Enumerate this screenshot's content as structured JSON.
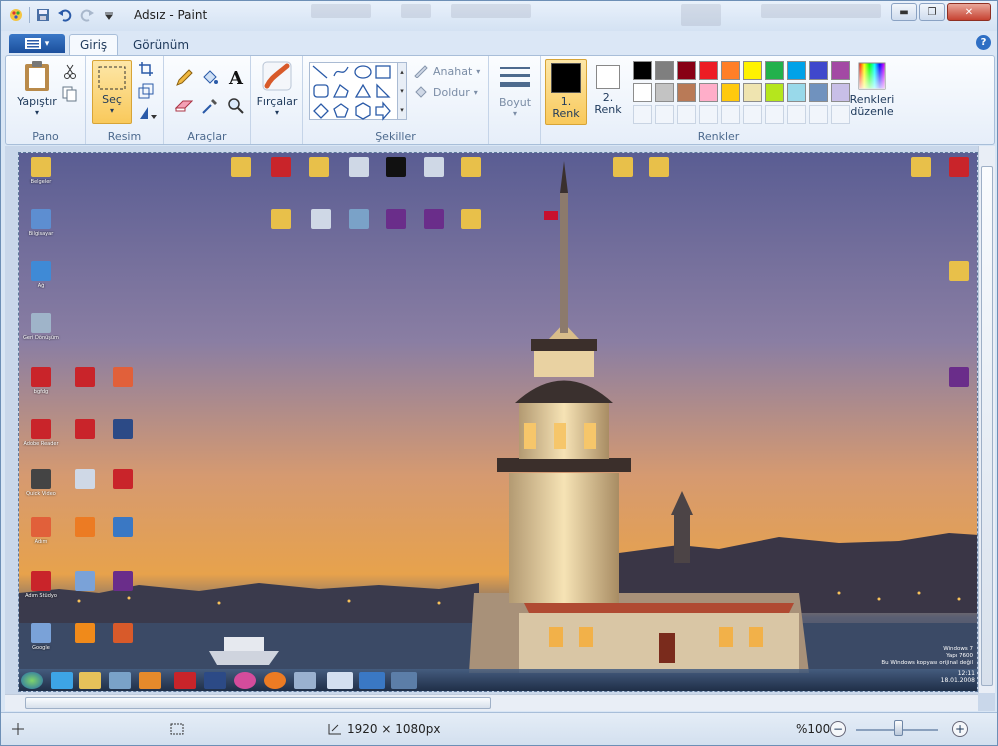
{
  "window": {
    "title": "Adsız - Paint",
    "min_glyph": "▬",
    "max_glyph": "❐",
    "close_glyph": "✕"
  },
  "tabs": {
    "app_menu_glyph": "▾",
    "items": [
      "Giriş",
      "Görünüm"
    ],
    "help_glyph": "?"
  },
  "ribbon": {
    "pano": {
      "label": "Pano",
      "paste": "Yapıştır"
    },
    "resim": {
      "label": "Resim",
      "select": "Seç"
    },
    "araclar": {
      "label": "Araçlar"
    },
    "fircalar": {
      "label": "Fırçalar"
    },
    "sekiller": {
      "label": "Şekiller",
      "outline": "Anahat",
      "fill": "Doldur"
    },
    "boyut": {
      "label": "Boyut"
    },
    "renkler": {
      "label": "Renkler",
      "color1": "1.\nRenk",
      "color1_a": "1.",
      "color1_b": "Renk",
      "color2_a": "2.",
      "color2_b": "Renk",
      "edit_a": "Renkleri",
      "edit_b": "düzenle",
      "palette_row1": [
        "#000000",
        "#7f7f7f",
        "#880015",
        "#ed1c24",
        "#ff7f27",
        "#fff200",
        "#22b14c",
        "#00a2e8",
        "#3f48cc",
        "#a349a4"
      ],
      "palette_row2": [
        "#ffffff",
        "#c3c3c3",
        "#b97a57",
        "#ffaec9",
        "#ffc90e",
        "#efe4b0",
        "#b5e61d",
        "#99d9ea",
        "#7092be",
        "#c8bfe7"
      ]
    }
  },
  "status": {
    "size": "1920 × 1080px",
    "zoom": "%100",
    "zoom_minus": "−",
    "zoom_plus": "+"
  },
  "desktop": {
    "icons": [
      {
        "label": "Belgeler",
        "color": "#e8c04a"
      },
      {
        "label": "Bilgisayar",
        "color": "#5d8ed1"
      },
      {
        "label": "Ağ",
        "color": "#3f8ad6"
      },
      {
        "label": "Geri Dönüşüm",
        "color": "#9fb4c9"
      },
      {
        "label": "bgfdg",
        "color": "#c9242a"
      },
      {
        "label": "Adobe Reader",
        "color": "#c9242a"
      },
      {
        "label": "Quick Video",
        "color": "#444444"
      },
      {
        "label": "Adım",
        "color": "#e1603a"
      },
      {
        "label": "Adım Stüdyo",
        "color": "#c9242a"
      },
      {
        "label": "Google",
        "color": "#7aa2d8"
      }
    ],
    "clock_line1": "Windows 7",
    "clock_line2": "Yapı 7600",
    "clock_line3": "Bu Windows kopyası orijinal değil",
    "clock_time": "12:11",
    "clock_date": "18.01.2008"
  }
}
